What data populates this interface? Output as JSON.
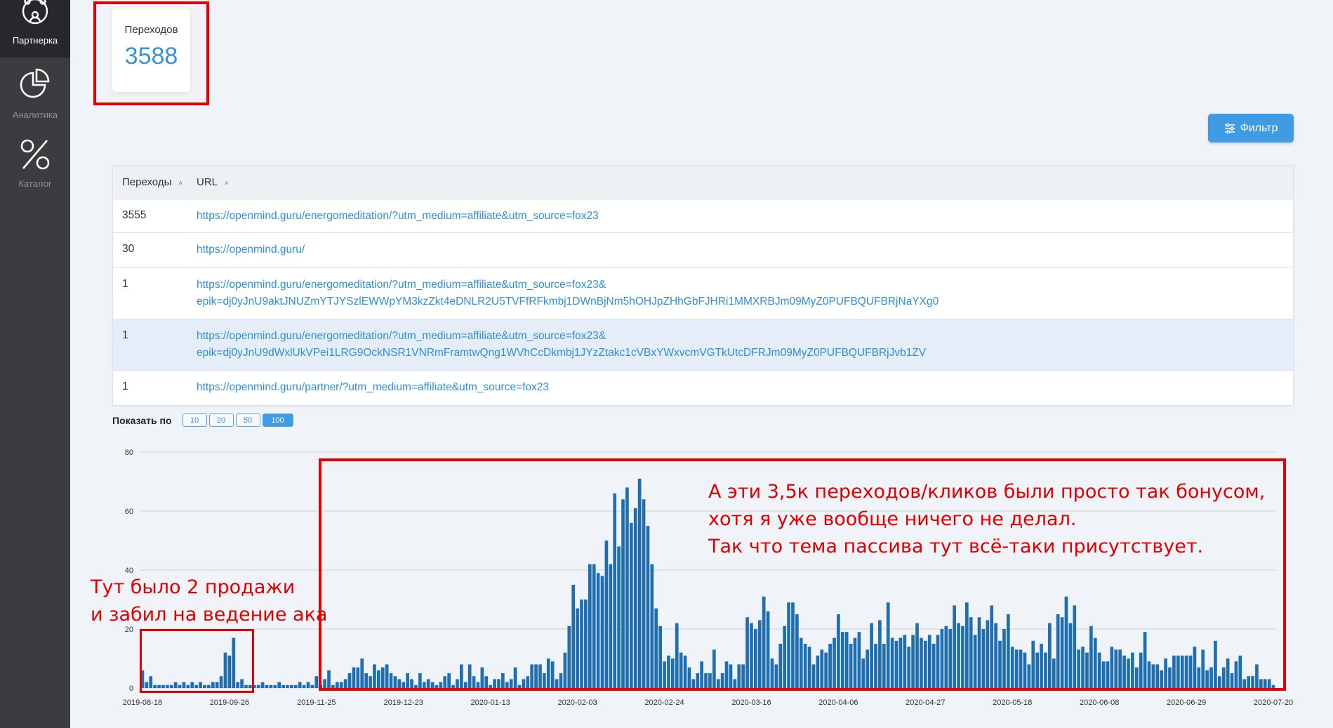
{
  "sidebar": {
    "items": [
      {
        "label": "Партнерка",
        "icon": "partners-icon"
      },
      {
        "label": "Аналитика",
        "icon": "pie-chart-icon"
      },
      {
        "label": "Каталог",
        "icon": "percent-icon"
      }
    ]
  },
  "stat": {
    "label": "Переходов",
    "value": "3588"
  },
  "filter_label": "Фильтр",
  "table": {
    "headers": [
      "Переходы",
      "URL"
    ],
    "rows": [
      {
        "count": "3555",
        "url": "https://openmind.guru/energomeditation/?utm_medium=affiliate&utm_source=fox23",
        "url2": ""
      },
      {
        "count": "30",
        "url": "https://openmind.guru/",
        "url2": ""
      },
      {
        "count": "1",
        "url": "https://openmind.guru/energomeditation/?utm_medium=affiliate&utm_source=fox23&",
        "url2": "epik=dj0yJnU9aktJNUZmYTJYSzlEWWpYM3kzZkt4eDNLR2U5TVFfRFkmbj1DWnBjNm5hOHJpZHhGbFJHRi1MMXRBJm09MyZ0PUFBQUFBRjNaYXg0"
      },
      {
        "count": "1",
        "url": "https://openmind.guru/energomeditation/?utm_medium=affiliate&utm_source=fox23&",
        "url2": "epik=dj0yJnU9dWxlUkVPei1LRG9OckNSR1VNRmFramtwQng1WVhCcDkmbj1JYzZtakc1cVBxYWxvcmVGTkUtcDFRJm09MyZ0PUFBQUFBRjJvb1ZV"
      },
      {
        "count": "1",
        "url": "https://openmind.guru/partner/?utm_medium=affiliate&utm_source=fox23",
        "url2": ""
      }
    ]
  },
  "pager": {
    "label": "Показать по",
    "options": [
      "10",
      "20",
      "50",
      "100"
    ],
    "selected": "100"
  },
  "annotations": {
    "left": [
      "Тут было 2 продажи",
      "и забил на ведение ака"
    ],
    "right": [
      "А эти 3,5к переходов/кликов были просто так бонусом,",
      "хотя я уже вообще ничего не делал.",
      "Так что тема пассива тут всё-таки присутствует."
    ]
  },
  "colors": {
    "bar": "#1f6fb0",
    "accent": "#3f9be3",
    "annotation": "#e60000"
  },
  "chart_data": {
    "type": "bar",
    "title": "",
    "xlabel": "",
    "ylabel": "",
    "ylim": [
      0,
      80
    ],
    "grid": true,
    "yticks": [
      0,
      20,
      40,
      60,
      80
    ],
    "xtick_labels": [
      "2019-08-18",
      "2019-09-26",
      "2019-11-25",
      "2019-12-23",
      "2020-01-13",
      "2020-02-03",
      "2020-02-24",
      "2020-03-16",
      "2020-04-06",
      "2020-04-27",
      "2020-05-18",
      "2020-06-08",
      "2020-06-29",
      "2020-07-20"
    ],
    "xtick_every": 21,
    "values": [
      6,
      2,
      4,
      1,
      1,
      1,
      1,
      1,
      2,
      1,
      2,
      1,
      2,
      1,
      2,
      1,
      1,
      2,
      2,
      4,
      12,
      11,
      17,
      2,
      3,
      1,
      1,
      1,
      1,
      2,
      1,
      1,
      1,
      2,
      1,
      1,
      1,
      1,
      2,
      1,
      2,
      1,
      4,
      1,
      3,
      6,
      1,
      2,
      2,
      3,
      5,
      7,
      7,
      10,
      5,
      4,
      8,
      6,
      7,
      8,
      5,
      4,
      3,
      2,
      5,
      3,
      1,
      5,
      2,
      3,
      2,
      1,
      2,
      4,
      5,
      1,
      3,
      8,
      2,
      8,
      4,
      2,
      7,
      4,
      1,
      3,
      3,
      5,
      2,
      3,
      7,
      1,
      3,
      4,
      8,
      8,
      8,
      5,
      10,
      9,
      3,
      5,
      12,
      21,
      35,
      27,
      30,
      30,
      42,
      42,
      39,
      38,
      50,
      42,
      66,
      48,
      64,
      68,
      56,
      61,
      71,
      64,
      55,
      42,
      27,
      21,
      9,
      11,
      10,
      22,
      12,
      11,
      7,
      3,
      5,
      9,
      5,
      5,
      13,
      3,
      5,
      9,
      8,
      3,
      8,
      8,
      24,
      22,
      20,
      23,
      31,
      26,
      10,
      8,
      15,
      21,
      29,
      29,
      25,
      17,
      15,
      14,
      8,
      11,
      13,
      12,
      15,
      17,
      25,
      19,
      19,
      15,
      17,
      19,
      10,
      13,
      22,
      15,
      23,
      15,
      29,
      17,
      16,
      17,
      18,
      14,
      18,
      22,
      17,
      16,
      18,
      15,
      18,
      20,
      21,
      20,
      28,
      22,
      21,
      29,
      24,
      18,
      24,
      20,
      23,
      28,
      22,
      16,
      20,
      25,
      14,
      13,
      13,
      12,
      8,
      16,
      12,
      15,
      12,
      22,
      10,
      25,
      24,
      31,
      22,
      28,
      13,
      14,
      12,
      21,
      17,
      12,
      9,
      9,
      14,
      13,
      13,
      11,
      10,
      12,
      7,
      12,
      19,
      9,
      8,
      8,
      6,
      10,
      7,
      11,
      11,
      11,
      11,
      11,
      14,
      7,
      13,
      6,
      7,
      16,
      4,
      7,
      10,
      5,
      9,
      11,
      3,
      4,
      4,
      8,
      3,
      3,
      3,
      1
    ]
  }
}
